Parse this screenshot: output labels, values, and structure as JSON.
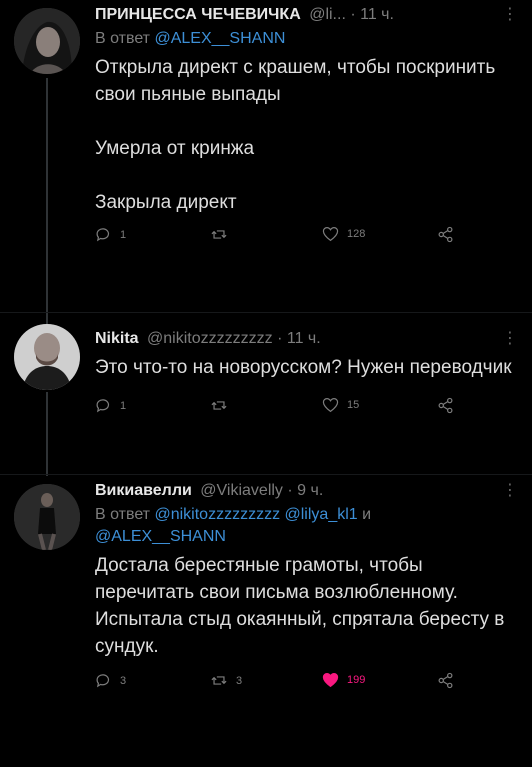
{
  "tweets": [
    {
      "author": "ПРИНЦЕССА ЧЕЧЕВИЧКА",
      "handle": "@li...",
      "time": "· 11 ч.",
      "reply_prefix": "В ответ",
      "reply_mentions": "@ALEX__SHANN",
      "body": [
        "Открыла директ с крашем, чтобы поскринить свои пьяные выпады",
        "Умерла от кринжа",
        "Закрыла директ"
      ],
      "replies": "1",
      "retweets": "",
      "likes": "128"
    },
    {
      "author": "Nikita",
      "handle": "@nikitozzzzzzzzz",
      "time": "· 11 ч.",
      "reply_prefix": "",
      "reply_mentions": "",
      "body": [
        "Это что-то на новорусском? Нужен переводчик"
      ],
      "replies": "1",
      "retweets": "",
      "likes": "15"
    },
    {
      "author": "Викиавелли",
      "handle": "@Vikiavelly",
      "time": "· 9 ч.",
      "reply_prefix": "В ответ",
      "reply_mentions_1": "@nikitozzzzzzzzz @lilya_kl1",
      "reply_and": "и",
      "reply_mentions_2": "@ALEX__SHANN",
      "body": [
        "Достала берестяные грамоты, чтобы перечитать свои письма возлюбленному. Испытала стыд окаянный, спрятала бересту в сундук."
      ],
      "replies": "3",
      "retweets": "3",
      "likes": "199"
    }
  ],
  "more_glyph": "⋮",
  "colors": {
    "background": "#000000",
    "mention": "#3d8fd6",
    "like_active": "#f91880"
  }
}
